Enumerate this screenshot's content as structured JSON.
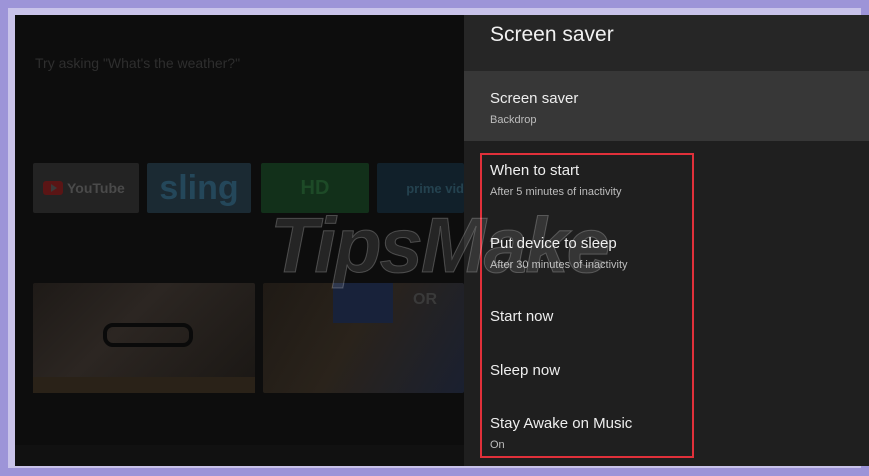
{
  "home": {
    "assistant_hint": "Try asking \"What's the weather?\"",
    "apps": [
      {
        "label": "YouTube"
      },
      {
        "label": "sling"
      },
      {
        "label": "HD"
      },
      {
        "label": "prime vid"
      }
    ],
    "thumb_overlay_text": "OR"
  },
  "watermark": "TipsMake",
  "panel": {
    "title": "Screen saver",
    "items": [
      {
        "title": "Screen saver",
        "subtitle": "Backdrop"
      },
      {
        "title": "When to start",
        "subtitle": "After 5 minutes of inactivity"
      },
      {
        "title": "Put device to sleep",
        "subtitle": "After 30 minutes of inactivity"
      },
      {
        "title": "Start now",
        "subtitle": ""
      },
      {
        "title": "Sleep now",
        "subtitle": ""
      },
      {
        "title": "Stay Awake on Music",
        "subtitle": "On"
      }
    ]
  },
  "colors": {
    "frame": "#9d94d8",
    "highlight": "#e0303a",
    "panel": "#1f1f1f",
    "selected": "#373737"
  }
}
